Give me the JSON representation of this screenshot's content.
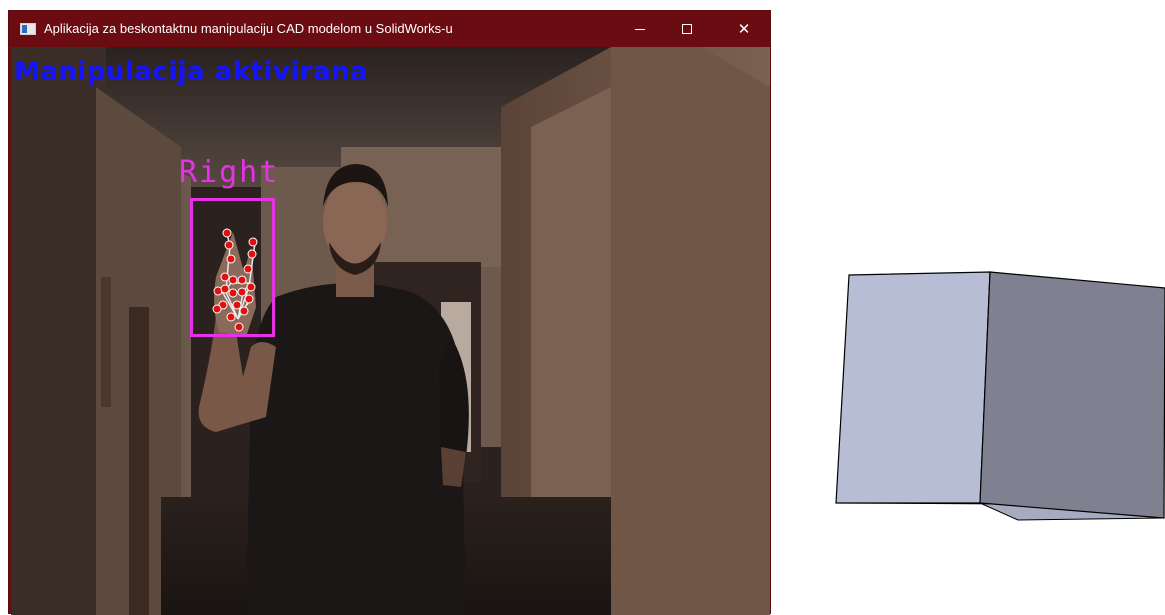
{
  "window": {
    "title": "Aplikacija za beskontaktnu manipulaciju CAD modelom u SolidWorks-u",
    "icon": "app-window-icon",
    "titlebar_color": "#6b0b12",
    "controls": {
      "minimize_icon": "minimize-icon",
      "maximize_icon": "maximize-icon",
      "close_icon": "close-icon",
      "close_glyph": "✕"
    }
  },
  "overlay": {
    "status_text": "Manipulacija aktivirana",
    "status_color": "#1414ff",
    "hand_label": "Right",
    "hand_color": "#e632e6",
    "landmark_color": "#e01010"
  },
  "cad_model": {
    "shape": "cube",
    "face_colors": [
      "#b7bdd4",
      "#7f8090",
      "#a6abbf"
    ]
  }
}
